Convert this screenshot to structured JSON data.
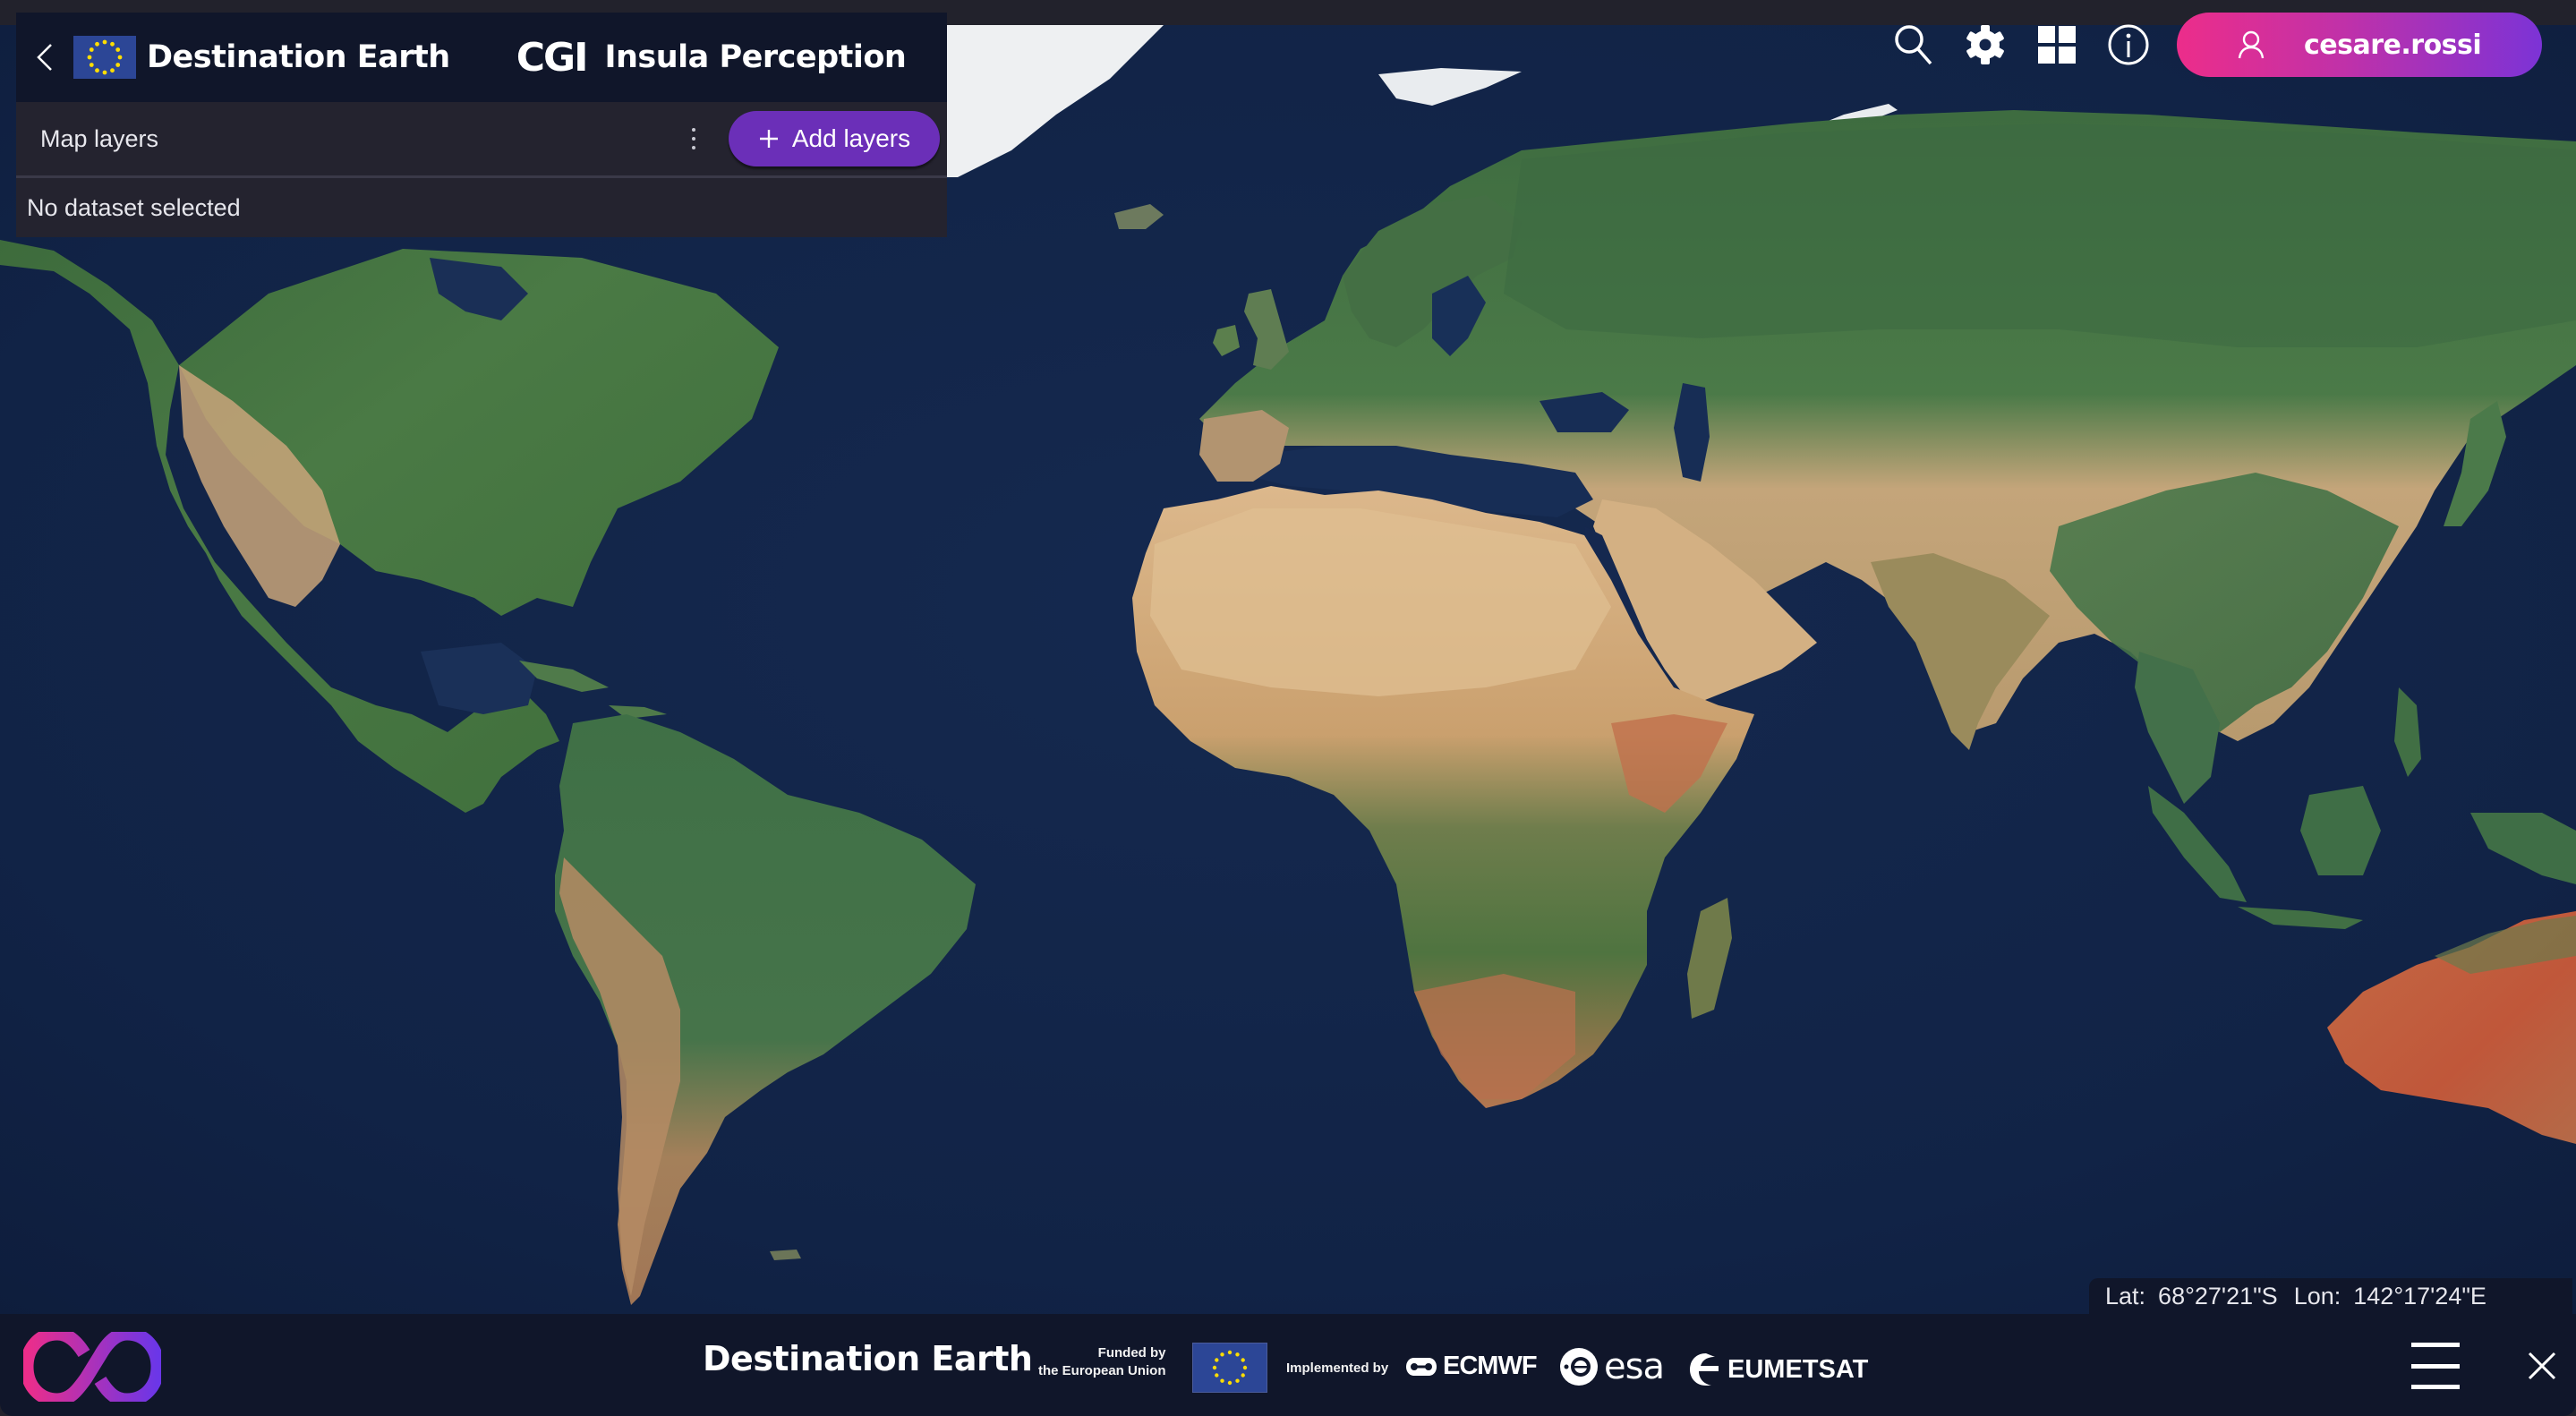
{
  "header": {
    "back_label": "Back",
    "brand": "Destination Earth",
    "partner_logo": "CGI",
    "product_name": "Insula Perception"
  },
  "layers_panel": {
    "title": "Map layers",
    "more_menu": "kebab-menu-icon",
    "add_button_label": "Add layers",
    "empty_state": "No dataset selected"
  },
  "toolbar": {
    "icons": [
      "search-icon",
      "gear-icon",
      "grid-icon",
      "info-icon"
    ],
    "user": {
      "icon": "user-icon",
      "username": "cesare.rossi"
    }
  },
  "map": {
    "type": "satellite-basemap",
    "view": "world"
  },
  "coordinates": {
    "lat_label": "Lat:",
    "lat_value": "68°27'21\"S",
    "lon_label": "Lon:",
    "lon_value": "142°17'24\"E"
  },
  "footer": {
    "brand": "Destination Earth",
    "funded_line1": "Funded by",
    "funded_line2": "the European Union",
    "implemented_by": "Implemented by",
    "partners": [
      "ECMWF",
      "esa",
      "EUMETSAT"
    ],
    "menu_icon": "hamburger-menu-icon",
    "close_icon": "close-icon"
  },
  "colors": {
    "panel_header_bg": "#10162a",
    "panel_body_bg": "#24232f",
    "accent_purple": "#6b2fb8",
    "user_gradient_start": "#ec2d8a",
    "user_gradient_end": "#7c33d6",
    "ocean": "#13254a"
  }
}
